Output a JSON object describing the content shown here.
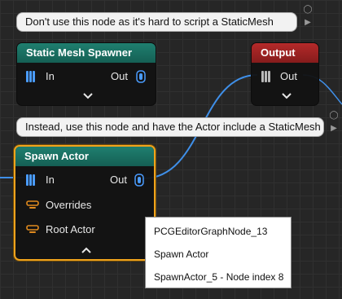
{
  "comments": {
    "top": "Don't use this node as it's hard to script a  StaticMesh",
    "middle": "Instead, use this node and have the Actor include a StaticMesh"
  },
  "nodes": {
    "static_mesh_spawner": {
      "title": "Static Mesh Spawner",
      "in": "In",
      "out": "Out"
    },
    "output": {
      "title": "Output",
      "out": "Out"
    },
    "spawn_actor": {
      "title": "Spawn Actor",
      "in": "In",
      "out": "Out",
      "overrides": "Overrides",
      "root_actor": "Root Actor"
    }
  },
  "tooltip": {
    "lines": [
      "PCGEditorGraphNode_13",
      "Spawn Actor",
      "SpawnActor_5 - Node index 8"
    ]
  },
  "colors": {
    "pin_blue": "#4a9cff",
    "pin_gray": "#b8b8b8",
    "pin_orange": "#e08a1e",
    "selection": "#f0a31c",
    "header_teal": "#1c766a",
    "header_red": "#a82424"
  },
  "icons": [
    "pin-stack-icon",
    "chevron-down-icon",
    "chevron-up-icon",
    "pin-param-icon",
    "comment-bubble-icon"
  ]
}
